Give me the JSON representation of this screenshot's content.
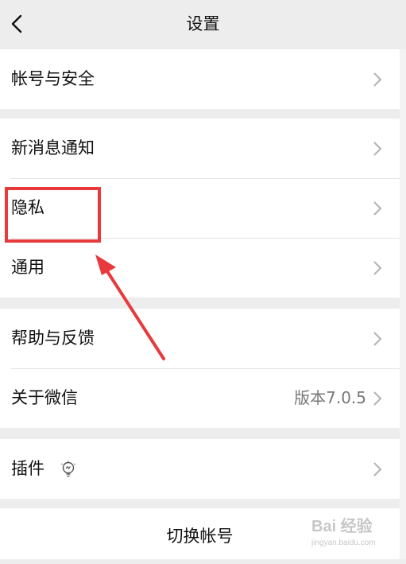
{
  "nav": {
    "title": "设置",
    "back_icon": "chevron-left-icon"
  },
  "groups": [
    {
      "items": [
        {
          "label": "帐号与安全",
          "value": ""
        }
      ]
    },
    {
      "items": [
        {
          "label": "新消息通知",
          "value": ""
        },
        {
          "label": "隐私",
          "value": ""
        },
        {
          "label": "通用",
          "value": ""
        }
      ]
    },
    {
      "items": [
        {
          "label": "帮助与反馈",
          "value": ""
        },
        {
          "label": "关于微信",
          "value": "版本7.0.5"
        }
      ]
    },
    {
      "items": [
        {
          "label": "插件",
          "value": "",
          "icon": "lightbulb-icon"
        }
      ]
    }
  ],
  "switch_account": {
    "label": "切换帐号"
  },
  "annotation": {
    "highlight_color": "#e8393d",
    "target": "隐私"
  },
  "watermark": {
    "logo": "Bai 经验",
    "sub": "jingyan.baidu.com"
  }
}
